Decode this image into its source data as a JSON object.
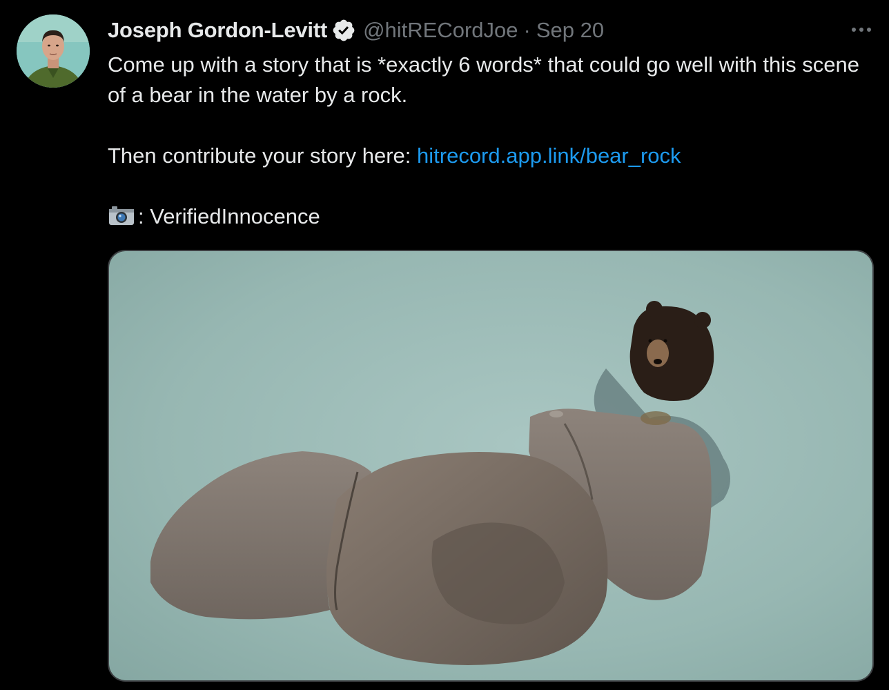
{
  "tweet": {
    "author": {
      "display_name": "Joseph Gordon-Levitt",
      "handle": "@hitRECordJoe",
      "verified": true,
      "avatar_icon": "profile-photo"
    },
    "separator": "·",
    "date": "Sep 20",
    "text_line_1": "Come up with a story that is *exactly 6 words* that could go well with this scene of a bear in the water by a rock.",
    "text_line_2_prefix": "Then contribute your story here: ",
    "link_text": "hitrecord.app.link/bear_rock",
    "credit_icon": "camera-icon",
    "credit_text": ": VerifiedInnocence",
    "media": {
      "description_icon": "photo-bear-on-rock"
    },
    "more_icon": "more-horizontal-icon"
  },
  "colors": {
    "background": "#000000",
    "text_primary": "#e7e9ea",
    "text_secondary": "#71767b",
    "link": "#1d9bf0"
  }
}
